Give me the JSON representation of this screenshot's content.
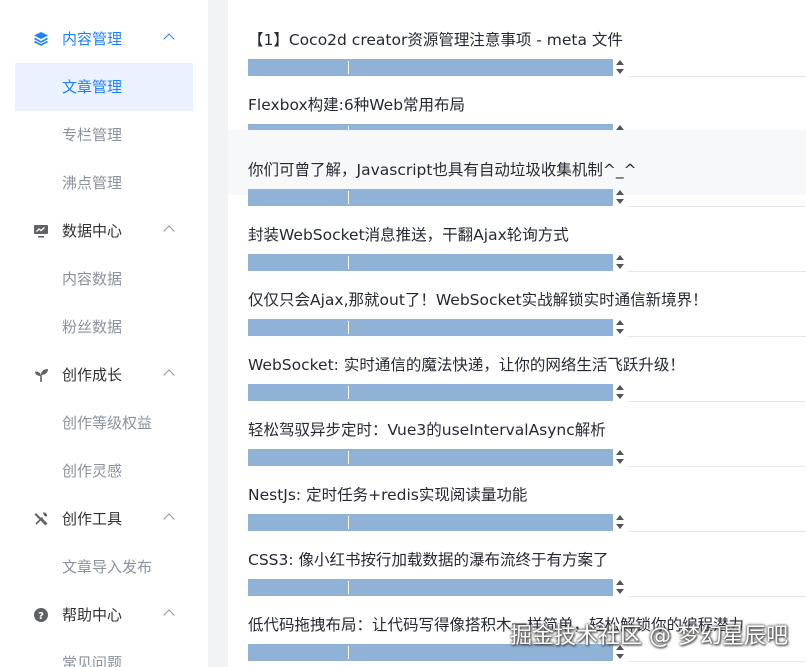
{
  "sidebar": {
    "groups": [
      {
        "label": "内容管理",
        "icon": "layers-icon",
        "active": true,
        "items": [
          {
            "label": "文章管理",
            "selected": true
          },
          {
            "label": "专栏管理"
          },
          {
            "label": "沸点管理"
          }
        ]
      },
      {
        "label": "数据中心",
        "icon": "monitor-chart-icon",
        "items": [
          {
            "label": "内容数据"
          },
          {
            "label": "粉丝数据"
          }
        ]
      },
      {
        "label": "创作成长",
        "icon": "sprout-icon",
        "items": [
          {
            "label": "创作等级权益"
          },
          {
            "label": "创作灵感"
          }
        ]
      },
      {
        "label": "创作工具",
        "icon": "tools-icon",
        "items": [
          {
            "label": "文章导入发布"
          }
        ]
      },
      {
        "label": "帮助中心",
        "icon": "question-circle-icon",
        "items": [
          {
            "label": "常见问题"
          }
        ]
      }
    ]
  },
  "articles": [
    {
      "title": "【1】Coco2d creator资源管理注意事项 - meta 文件"
    },
    {
      "title": "Flexbox构建:6种Web常用布局"
    },
    {
      "title": "你们可曾了解，Javascript也具有自动垃圾收集机制^_^"
    },
    {
      "title": "封装WebSocket消息推送，干翻Ajax轮询方式"
    },
    {
      "title": "仅仅只会Ajax,那就out了！WebSocket实战解锁实时通信新境界！"
    },
    {
      "title": "WebSocket: 实时通信的魔法快递，让你的网络生活飞跃升级！"
    },
    {
      "title": "轻松驾驭异步定时：Vue3的useIntervalAsync解析"
    },
    {
      "title": "NestJs: 定时任务+redis实现阅读量功能"
    },
    {
      "title": "CSS3: 像小红书按行加载数据的瀑布流终于有方案了"
    },
    {
      "title": "低代码拖拽布局：让代码写得像搭积木一样简单，轻松解锁你的编程潜力"
    }
  ],
  "watermark": "掘金技术社区 @ 梦幻星辰吧",
  "colors": {
    "accent": "#1e80ff",
    "meta_bar": "#8fb2d6",
    "selected_bg": "#eaf2ff"
  }
}
